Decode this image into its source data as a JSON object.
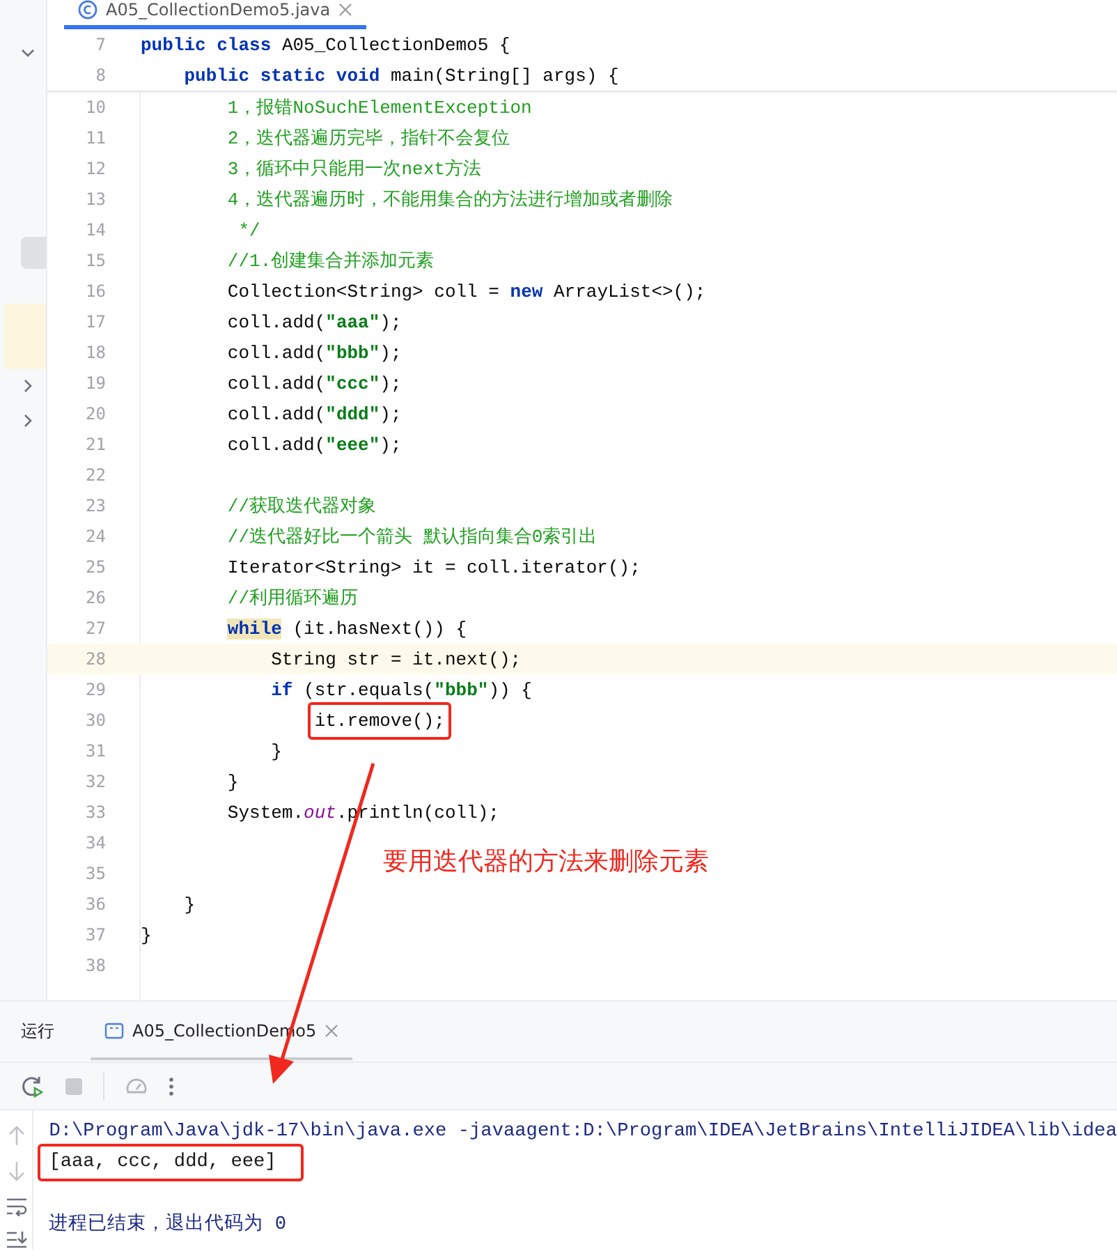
{
  "editor_tab": {
    "title": "A05_CollectionDemo5.java",
    "selected": true
  },
  "sticky_lines": [
    {
      "number": "7",
      "tokens": [
        {
          "kind": "kw",
          "text": "public class"
        },
        {
          "kind": "plain",
          "text": " A05_CollectionDemo5 {"
        }
      ]
    },
    {
      "number": "8",
      "tokens": [
        {
          "kind": "kw",
          "text": "    public static void"
        },
        {
          "kind": "plain",
          "text": " main(String[] args) {"
        }
      ]
    }
  ],
  "lines": [
    {
      "number": "10",
      "current": false,
      "tokens": [
        {
          "kind": "comment",
          "text": "        1，报错NoSuchElementException"
        }
      ]
    },
    {
      "number": "11",
      "current": false,
      "tokens": [
        {
          "kind": "comment",
          "text": "        2，迭代器遍历完毕，指针不会复位"
        }
      ]
    },
    {
      "number": "12",
      "current": false,
      "tokens": [
        {
          "kind": "comment",
          "text": "        3，循环中只能用一次next方法"
        }
      ]
    },
    {
      "number": "13",
      "current": false,
      "tokens": [
        {
          "kind": "comment",
          "text": "        4，迭代器遍历时，不能用集合的方法进行增加或者删除"
        }
      ]
    },
    {
      "number": "14",
      "current": false,
      "tokens": [
        {
          "kind": "comment",
          "text": "         */"
        }
      ]
    },
    {
      "number": "15",
      "current": false,
      "tokens": [
        {
          "kind": "comment",
          "text": "        //1.创建集合并添加元素"
        }
      ]
    },
    {
      "number": "16",
      "current": false,
      "tokens": [
        {
          "kind": "plain",
          "text": "        Collection<String> coll = "
        },
        {
          "kind": "kw",
          "text": "new"
        },
        {
          "kind": "plain",
          "text": " ArrayList<>();"
        }
      ]
    },
    {
      "number": "17",
      "current": false,
      "tokens": [
        {
          "kind": "plain",
          "text": "        coll.add("
        },
        {
          "kind": "str",
          "text": "\"aaa\""
        },
        {
          "kind": "plain",
          "text": ");"
        }
      ]
    },
    {
      "number": "18",
      "current": false,
      "tokens": [
        {
          "kind": "plain",
          "text": "        coll.add("
        },
        {
          "kind": "str",
          "text": "\"bbb\""
        },
        {
          "kind": "plain",
          "text": ");"
        }
      ]
    },
    {
      "number": "19",
      "current": false,
      "tokens": [
        {
          "kind": "plain",
          "text": "        coll.add("
        },
        {
          "kind": "str",
          "text": "\"ccc\""
        },
        {
          "kind": "plain",
          "text": ");"
        }
      ]
    },
    {
      "number": "20",
      "current": false,
      "tokens": [
        {
          "kind": "plain",
          "text": "        coll.add("
        },
        {
          "kind": "str",
          "text": "\"ddd\""
        },
        {
          "kind": "plain",
          "text": ");"
        }
      ]
    },
    {
      "number": "21",
      "current": false,
      "tokens": [
        {
          "kind": "plain",
          "text": "        coll.add("
        },
        {
          "kind": "str",
          "text": "\"eee\""
        },
        {
          "kind": "plain",
          "text": ");"
        }
      ]
    },
    {
      "number": "22",
      "current": false
    },
    {
      "number": "23",
      "current": false,
      "tokens": [
        {
          "kind": "comment",
          "text": "        //获取迭代器对象"
        }
      ]
    },
    {
      "number": "24",
      "current": false,
      "tokens": [
        {
          "kind": "comment",
          "text": "        //迭代器好比一个箭头 默认指向集合0索引出"
        }
      ]
    },
    {
      "number": "25",
      "current": false,
      "tokens": [
        {
          "kind": "plain",
          "text": "        Iterator<String> it = coll.iterator();"
        }
      ]
    },
    {
      "number": "26",
      "current": false,
      "tokens": [
        {
          "kind": "comment",
          "text": "        //利用循环遍历"
        }
      ]
    },
    {
      "number": "27",
      "current": false,
      "tokens": [
        {
          "kind": "kw-match",
          "text": "        while"
        },
        {
          "kind": "plain",
          "text": " (it.hasNext()) {"
        }
      ]
    },
    {
      "number": "28",
      "current": true,
      "tokens": [
        {
          "kind": "plain",
          "text": "            String str = it.next();"
        }
      ]
    },
    {
      "number": "29",
      "current": false,
      "tokens": [
        {
          "kind": "kw",
          "text": "            if"
        },
        {
          "kind": "plain",
          "text": " (str.equals("
        },
        {
          "kind": "str",
          "text": "\"bbb\""
        },
        {
          "kind": "plain",
          "text": ")) {"
        }
      ]
    },
    {
      "number": "30",
      "current": false,
      "tokens": [
        {
          "kind": "boxed",
          "text": "                it.remove();"
        }
      ]
    },
    {
      "number": "31",
      "current": false,
      "tokens": [
        {
          "kind": "plain",
          "text": "            }"
        }
      ]
    },
    {
      "number": "32",
      "current": false,
      "tokens": [
        {
          "kind": "plain",
          "text": "        }"
        }
      ]
    },
    {
      "number": "33",
      "current": false,
      "tokens": [
        {
          "kind": "plain",
          "text": "        System."
        },
        {
          "kind": "field",
          "text": "out"
        },
        {
          "kind": "plain",
          "text": ".println(coll);"
        }
      ]
    },
    {
      "number": "34",
      "current": false
    },
    {
      "number": "35",
      "current": false
    },
    {
      "number": "36",
      "current": false,
      "tokens": [
        {
          "kind": "plain",
          "text": "    }"
        }
      ]
    },
    {
      "number": "37",
      "current": false,
      "tokens": [
        {
          "kind": "plain",
          "text": "}"
        }
      ]
    },
    {
      "number": "38",
      "current": false
    }
  ],
  "annotation": {
    "text": "要用迭代器的方法来删除元素"
  },
  "run_panel": {
    "title": "运行",
    "tab": {
      "title": "A05_CollectionDemo5",
      "selected": true
    },
    "output": [
      {
        "kind": "command",
        "text": "D:\\Program\\Java\\jdk-17\\bin\\java.exe -javaagent:D:\\Program\\IDEA\\JetBrains\\IntelliJIDEA\\lib\\idea"
      },
      {
        "kind": "boxed",
        "text": "[aaa, ccc, ddd, eee]"
      },
      {
        "kind": "blank"
      },
      {
        "kind": "system",
        "text": "进程已结束，退出代码为 0"
      }
    ]
  }
}
